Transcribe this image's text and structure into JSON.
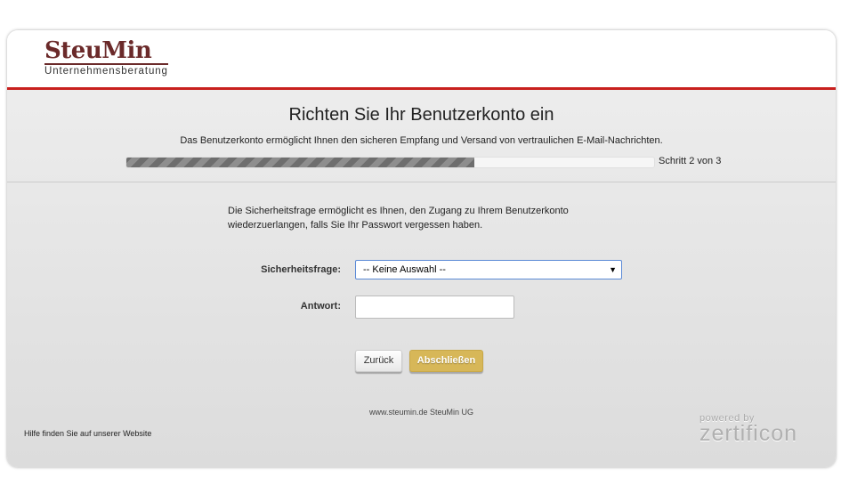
{
  "brand": {
    "name": "SteuMin",
    "tagline": "Unternehmensberatung",
    "accent": "#c8201e",
    "logo_color": "#6b2a2a"
  },
  "title": "Richten Sie Ihr Benutzerkonto ein",
  "subtitle": "Das Benutzerkonto ermöglicht Ihnen den sicheren Empfang und Versand von vertraulichen E-Mail-Nachrichten.",
  "progress": {
    "percent": 66,
    "label": "Schritt 2 von 3"
  },
  "info": "Die Sicherheitsfrage ermöglicht es Ihnen, den Zugang zu Ihrem Benutzerkonto wiederzuerlangen, falls Sie Ihr Passwort vergessen haben.",
  "form": {
    "question_label": "Sicherheitsfrage:",
    "question_value": "-- Keine Auswahl --",
    "answer_label": "Antwort:",
    "answer_value": ""
  },
  "buttons": {
    "back": "Zurück",
    "finish": "Abschließen",
    "finish_color": "#d7b758"
  },
  "footer": "www.steumin.de SteuMin UG",
  "help": "Hilfe finden Sie auf unserer Website",
  "powered": {
    "prefix": "powered by",
    "name": "zertificon"
  }
}
